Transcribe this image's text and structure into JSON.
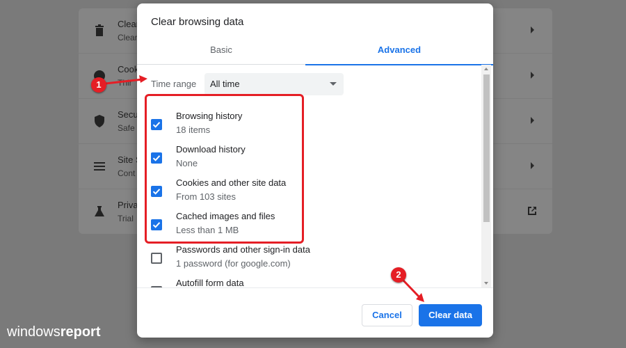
{
  "background": {
    "rows": [
      {
        "title": "Clear",
        "sub": "Clear",
        "icon": "trash-icon"
      },
      {
        "title": "Cook",
        "sub": "Thir",
        "icon": "cookie-icon"
      },
      {
        "title": "Secu",
        "sub": "Safe",
        "icon": "shield-icon"
      },
      {
        "title": "Site S",
        "sub": "Cont",
        "icon": "sliders-icon"
      },
      {
        "title": "Priva",
        "sub": "Trial",
        "icon": "flask-icon"
      }
    ]
  },
  "dialog": {
    "title": "Clear browsing data",
    "tabs": {
      "basic": "Basic",
      "advanced": "Advanced",
      "active": "advanced"
    },
    "time_range": {
      "label": "Time range",
      "value": "All time"
    },
    "items": [
      {
        "title": "Browsing history",
        "sub": "18 items",
        "checked": true
      },
      {
        "title": "Download history",
        "sub": "None",
        "checked": true
      },
      {
        "title": "Cookies and other site data",
        "sub": "From 103 sites",
        "checked": true
      },
      {
        "title": "Cached images and files",
        "sub": "Less than 1 MB",
        "checked": true
      },
      {
        "title": "Passwords and other sign-in data",
        "sub": "1 password (for google.com)",
        "checked": false
      },
      {
        "title": "Autofill form data",
        "sub": "",
        "checked": false
      }
    ],
    "buttons": {
      "cancel": "Cancel",
      "clear": "Clear data"
    }
  },
  "annotations": {
    "step1": "1",
    "step2": "2",
    "color": "#e51e25"
  },
  "watermark": {
    "part1": "windows",
    "part2": "report"
  },
  "colors": {
    "accent": "#1a73e8",
    "annotation": "#e51e25"
  }
}
